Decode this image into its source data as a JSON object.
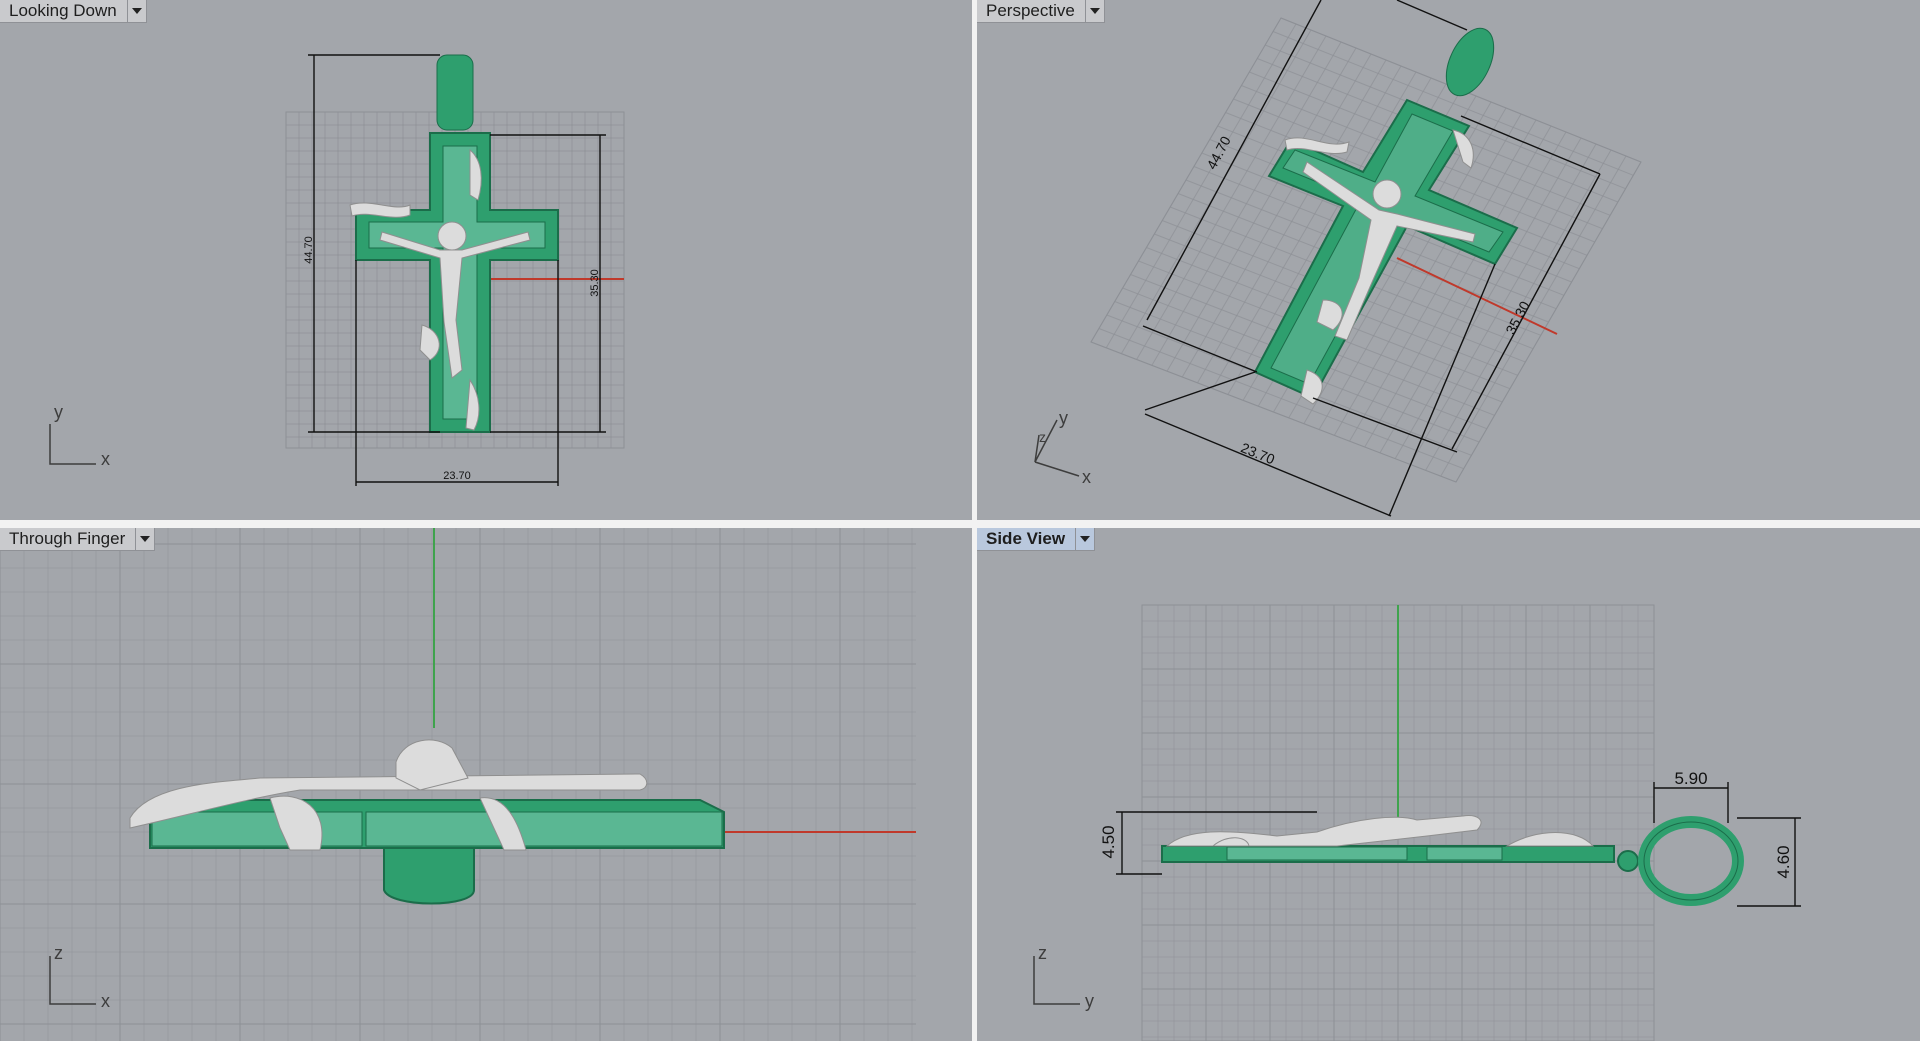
{
  "viewports": {
    "top_left": {
      "label": "Looking Down",
      "axes": {
        "a": "y",
        "b": "x"
      }
    },
    "top_right": {
      "label": "Perspective",
      "axes": {
        "a": "y",
        "b": "x",
        "c": "z"
      }
    },
    "bottom_left": {
      "label": "Through Finger",
      "axes": {
        "a": "z",
        "b": "x"
      }
    },
    "bottom_right": {
      "label": "Side View",
      "axes": {
        "a": "z",
        "b": "y"
      }
    }
  },
  "dimensions": {
    "height_total": "44.70",
    "height_body": "35.30",
    "width": "23.70",
    "bail_width": "5.90",
    "relief_height": "4.50",
    "bail_height": "4.60"
  },
  "colors": {
    "viewport_bg": "#a3a6ab",
    "model_green": "#2e9f6e",
    "relief_silver": "#d8d8d8",
    "x_axis": "#c0392b",
    "y_axis": "#3fa34d",
    "grid": "#8d9096"
  },
  "active_viewport": "bottom_right"
}
